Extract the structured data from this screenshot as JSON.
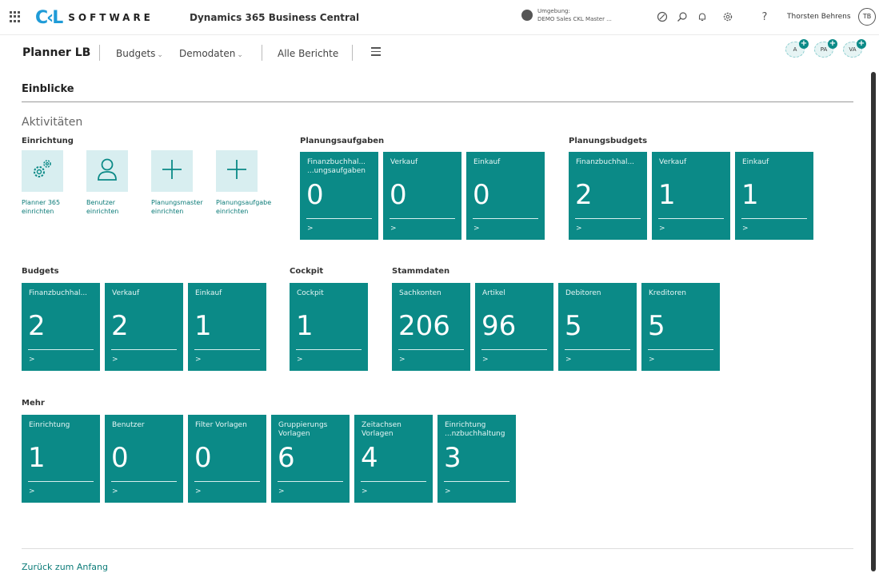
{
  "topbar": {
    "logo_mark": "C‹L",
    "logo_text": "SOFTWARE",
    "product": "Dynamics 365 Business Central",
    "env_label": "Umgebung:",
    "env_value": "DEMO Sales CKL Master ...",
    "user_name": "Thorsten Behrens",
    "user_initials": "TB"
  },
  "nav": {
    "title": "Planner LB",
    "items": [
      "Budgets",
      "Demodaten",
      "Alle Berichte"
    ],
    "roles": [
      "A",
      "PA",
      "VA"
    ]
  },
  "section": {
    "title": "Einblicke",
    "activities": "Aktivitäten"
  },
  "groups": {
    "einrichtung": "Einrichtung",
    "planungsaufgaben": "Planungsaufgaben",
    "planungsbudgets": "Planungsbudgets",
    "budgets": "Budgets",
    "cockpit": "Cockpit",
    "stammdaten": "Stammdaten",
    "mehr": "Mehr"
  },
  "actions": [
    {
      "label": "Planner 365 einrichten",
      "icon": "gears-icon"
    },
    {
      "label": "Benutzer einrichten",
      "icon": "person-icon"
    },
    {
      "label": "Planungsmaster einrichten",
      "icon": "plus-icon"
    },
    {
      "label": "Planungsaufgabe einrichten",
      "icon": "plus-icon"
    }
  ],
  "cues": {
    "planungsaufgaben": [
      {
        "title": "Finanzbuchhal... ...ungsaufgaben",
        "value": "0"
      },
      {
        "title": "Verkauf",
        "value": "0"
      },
      {
        "title": "Einkauf",
        "value": "0"
      }
    ],
    "planungsbudgets": [
      {
        "title": "Finanzbuchhal...",
        "value": "2"
      },
      {
        "title": "Verkauf",
        "value": "1"
      },
      {
        "title": "Einkauf",
        "value": "1"
      }
    ],
    "budgets": [
      {
        "title": "Finanzbuchhal...",
        "value": "2"
      },
      {
        "title": "Verkauf",
        "value": "2"
      },
      {
        "title": "Einkauf",
        "value": "1"
      }
    ],
    "cockpit": [
      {
        "title": "Cockpit",
        "value": "1"
      }
    ],
    "stammdaten": [
      {
        "title": "Sachkonten",
        "value": "206"
      },
      {
        "title": "Artikel",
        "value": "96"
      },
      {
        "title": "Debitoren",
        "value": "5"
      },
      {
        "title": "Kreditoren",
        "value": "5"
      }
    ],
    "mehr": [
      {
        "title": "Einrichtung",
        "value": "1"
      },
      {
        "title": "Benutzer",
        "value": "0"
      },
      {
        "title": "Filter Vorlagen",
        "value": "0"
      },
      {
        "title": "Gruppierungs Vorlagen",
        "value": "6"
      },
      {
        "title": "Zeitachsen Vorlagen",
        "value": "4"
      },
      {
        "title": "Einrichtung ...nzbuchhaltung",
        "value": "3"
      }
    ],
    "arrow": ">"
  },
  "footer": {
    "back": "Zurück zum Anfang"
  },
  "colors": {
    "tile": "#0b8a87",
    "action_bg": "#d8eef0",
    "link": "#0b7b78"
  }
}
